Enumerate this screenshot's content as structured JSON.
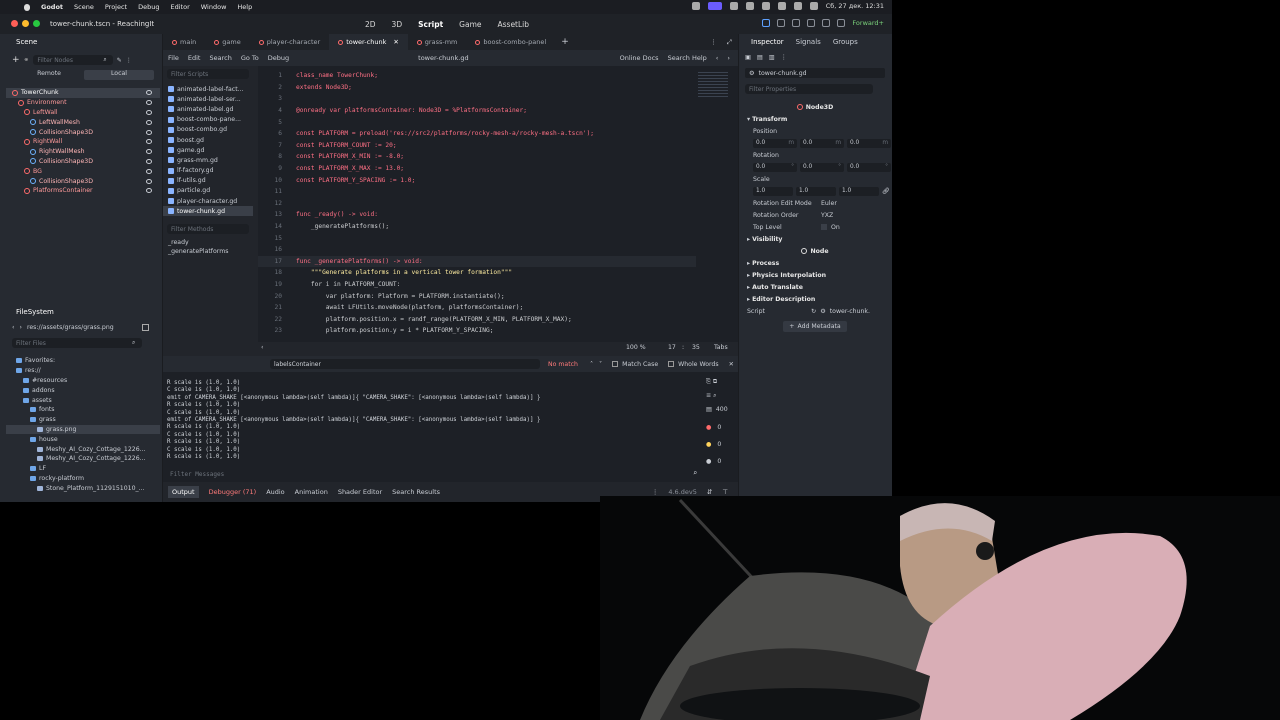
{
  "macbar": {
    "app": "Godot",
    "menus": [
      "Scene",
      "Project",
      "Debug",
      "Editor",
      "Window",
      "Help"
    ],
    "datetime": "Сб, 27 дек. 12:31"
  },
  "window": {
    "title": "tower-chunk.tscn - ReachingIt",
    "modes": [
      "2D",
      "3D",
      "Script",
      "Game",
      "AssetLib"
    ],
    "renderer": "Forward+"
  },
  "scene": {
    "tab": "Scene",
    "filter_placeholder": "Filter Nodes",
    "remote": "Remote",
    "local": "Local",
    "nodes": [
      {
        "label": "TowerChunk",
        "depth": 0
      },
      {
        "label": "Environment",
        "depth": 1
      },
      {
        "label": "LeftWall",
        "depth": 2
      },
      {
        "label": "LeftWallMesh",
        "depth": 3
      },
      {
        "label": "CollisionShape3D",
        "depth": 3
      },
      {
        "label": "RightWall",
        "depth": 2
      },
      {
        "label": "RightWallMesh",
        "depth": 3
      },
      {
        "label": "CollisionShape3D",
        "depth": 3
      },
      {
        "label": "BG",
        "depth": 2
      },
      {
        "label": "CollisionShape3D",
        "depth": 3
      },
      {
        "label": "PlatformsContainer",
        "depth": 2
      }
    ]
  },
  "filesystem": {
    "tab": "FileSystem",
    "path": "res://assets/grass/grass.png",
    "filter_placeholder": "Filter Files",
    "items": [
      {
        "label": "Favorites:",
        "depth": 0
      },
      {
        "label": "res://",
        "depth": 0
      },
      {
        "label": "#resources",
        "depth": 1
      },
      {
        "label": "addons",
        "depth": 1
      },
      {
        "label": "assets",
        "depth": 1
      },
      {
        "label": "fonts",
        "depth": 2
      },
      {
        "label": "grass",
        "depth": 2
      },
      {
        "label": "grass.png",
        "depth": 3
      },
      {
        "label": "house",
        "depth": 2
      },
      {
        "label": "Meshy_AI_Cozy_Cottage_1226...",
        "depth": 3
      },
      {
        "label": "Meshy_AI_Cozy_Cottage_1226...",
        "depth": 3
      },
      {
        "label": "LF",
        "depth": 2
      },
      {
        "label": "rocky-platform",
        "depth": 2
      },
      {
        "label": "Stone_Platform_1129151010_...",
        "depth": 3
      }
    ]
  },
  "script_tabs": [
    "main",
    "game",
    "player-character",
    "tower-chunk",
    "grass-mm",
    "boost-combo-panel"
  ],
  "script_menu": {
    "items": [
      "File",
      "Edit",
      "Search",
      "Go To",
      "Debug"
    ],
    "current": "tower-chunk.gd",
    "online_docs": "Online Docs",
    "search_help": "Search Help"
  },
  "script_list": {
    "filter_placeholder": "Filter Scripts",
    "files": [
      "animated-label-fact...",
      "animated-label-ser...",
      "animated-label.gd",
      "boost-combo-pane...",
      "boost-combo.gd",
      "boost.gd",
      "game.gd",
      "grass-mm.gd",
      "lf-factory.gd",
      "lf-utils.gd",
      "particle.gd",
      "player-character.gd",
      "tower-chunk.gd"
    ],
    "methods_placeholder": "Filter Methods",
    "methods": [
      "_ready",
      "_generatePlatforms"
    ]
  },
  "code": {
    "lines": [
      {
        "n": "1",
        "t": "class_name TowerChunk;"
      },
      {
        "n": "2",
        "t": "extends Node3D;"
      },
      {
        "n": "3",
        "t": ""
      },
      {
        "n": "4",
        "t": "@onready var platformsContainer: Node3D = %PlatformsContainer;"
      },
      {
        "n": "5",
        "t": ""
      },
      {
        "n": "6",
        "t": "const PLATFORM = preload('res://src2/platforms/rocky-mesh-a/rocky-mesh-a.tscn');"
      },
      {
        "n": "7",
        "t": "const PLATFORM_COUNT := 20;"
      },
      {
        "n": "8",
        "t": "const PLATFORM_X_MIN := -8.0;"
      },
      {
        "n": "9",
        "t": "const PLATFORM_X_MAX := 13.0;"
      },
      {
        "n": "10",
        "t": "const PLATFORM_Y_SPACING := 1.0;"
      },
      {
        "n": "11",
        "t": ""
      },
      {
        "n": "12",
        "t": ""
      },
      {
        "n": "13",
        "t": "func _ready() -> void:"
      },
      {
        "n": "14",
        "t": "    _generatePlatforms();"
      },
      {
        "n": "15",
        "t": ""
      },
      {
        "n": "16",
        "t": ""
      },
      {
        "n": "17",
        "t": "func _generatePlatforms() -> void:"
      },
      {
        "n": "18",
        "t": "    \"\"\"Generate platforms in a vertical tower formation\"\"\""
      },
      {
        "n": "19",
        "t": "    for i in PLATFORM_COUNT:"
      },
      {
        "n": "20",
        "t": "        var platform: Platform = PLATFORM.instantiate();"
      },
      {
        "n": "21",
        "t": "        await LFUtils.moveNode(platform, platformsContainer);"
      },
      {
        "n": "22",
        "t": "        platform.position.x = randf_range(PLATFORM_X_MIN, PLATFORM_X_MAX);"
      },
      {
        "n": "23",
        "t": "        platform.position.y = i * PLATFORM_Y_SPACING;"
      }
    ],
    "zoom": "100 %",
    "line": "17",
    "col": "35",
    "indent": "Tabs"
  },
  "find": {
    "query": "labelsContainer",
    "status": "No match",
    "match_case": "Match Case",
    "whole_words": "Whole Words"
  },
  "output": {
    "lines": [
      "R scale is (1.0, 1.0)",
      "C scale is (1.0, 1.0)",
      "emit of CAMERA_SHAKE [<anonymous lambda>(self lambda)]{ \"CAMERA_SHAKE\": [<anonymous lambda>(self lambda)] }",
      "R scale is (1.0, 1.0)",
      "C scale is (1.0, 1.0)",
      "emit of CAMERA_SHAKE [<anonymous lambda>(self lambda)]{ \"CAMERA_SHAKE\": [<anonymous lambda>(self lambda)] }",
      "R scale is (1.0, 1.0)",
      "C scale is (1.0, 1.0)",
      "R scale is (1.0, 1.0)",
      "C scale is (1.0, 1.0)",
      "R scale is (1.0, 1.0)"
    ],
    "filter_placeholder": "Filter Messages",
    "counts": {
      "log": "400",
      "errors": "0",
      "warnings": "0",
      "other": "0"
    }
  },
  "bottom_tabs": [
    "Output",
    "Debugger (71)",
    "Audio",
    "Animation",
    "Shader Editor",
    "Search Results"
  ],
  "version": "4.6.dev5",
  "inspector": {
    "tabs": [
      "Inspector",
      "Signals",
      "Groups"
    ],
    "resource": "tower-chunk.gd",
    "filter_placeholder": "Filter Properties",
    "node_type": "Node3D",
    "transform": "Transform",
    "position_label": "Position",
    "position": {
      "x": "0.0",
      "y": "0.0",
      "z": "0.0",
      "unit": "m"
    },
    "rotation_label": "Rotation",
    "rotation": {
      "x": "0.0",
      "y": "0.0",
      "z": "0.0",
      "unit": "°"
    },
    "scale_label": "Scale",
    "scale": {
      "x": "1.0",
      "y": "1.0",
      "z": "1.0"
    },
    "rotation_edit_mode_label": "Rotation Edit Mode",
    "rotation_edit_mode": "Euler",
    "rotation_order_label": "Rotation Order",
    "rotation_order": "YXZ",
    "top_level_label": "Top Level",
    "top_level": "On",
    "visibility": "Visibility",
    "node": "Node",
    "process": "Process",
    "physics_interp": "Physics Interpolation",
    "auto_translate": "Auto Translate",
    "editor_desc": "Editor Description",
    "script_label": "Script",
    "script_value": "tower-chunk.",
    "add_metadata": "Add Metadata"
  }
}
